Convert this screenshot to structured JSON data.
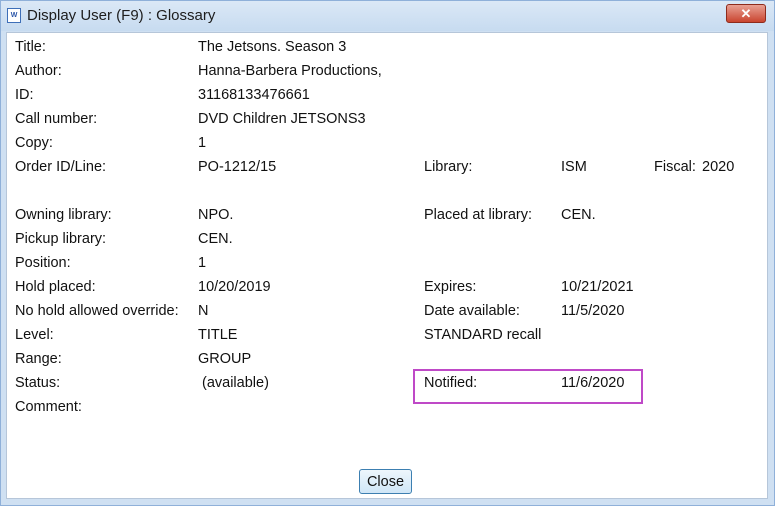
{
  "window": {
    "title": "Display User (F9) : Glossary",
    "close_glyph": "✕",
    "app_icon_text": "W"
  },
  "fields": {
    "title_label": "Title:",
    "title_value": "The Jetsons. Season 3",
    "author_label": "Author:",
    "author_value": "Hanna-Barbera Productions,",
    "id_label": "ID:",
    "id_value": "31168133476661",
    "call_label": "Call number:",
    "call_value": "DVD Children JETSONS3",
    "copy_label": "Copy:",
    "copy_value": "1",
    "order_label": "Order ID/Line:",
    "order_value": "PO-1212/15",
    "library_label": "Library:",
    "library_value": "ISM",
    "fiscal_label": "Fiscal:",
    "fiscal_value": "2020",
    "owning_label": "Owning library:",
    "owning_value": "NPO.",
    "placed_label": "Placed at library:",
    "placed_value": "CEN.",
    "pickup_label": "Pickup library:",
    "pickup_value": "CEN.",
    "position_label": "Position:",
    "position_value": "1",
    "holdplaced_label": "Hold placed:",
    "holdplaced_value": "10/20/2019",
    "expires_label": "Expires:",
    "expires_value": "10/21/2021",
    "nohold_label": "No hold allowed override:",
    "nohold_value": "N",
    "dateavail_label": "Date available:",
    "dateavail_value": "11/5/2020",
    "level_label": "Level:",
    "level_value": "TITLE",
    "recall_text": "STANDARD recall",
    "range_label": "Range:",
    "range_value": "GROUP",
    "status_label": "Status:",
    "status_value": "(available)",
    "notified_label": "Notified:",
    "notified_value": "11/6/2020",
    "comment_label": "Comment:"
  },
  "buttons": {
    "close_label": "Close"
  },
  "colors": {
    "highlight_border": "#bf49c7",
    "titlebar": "#cfe0f2",
    "close_button": "#c9452f"
  }
}
